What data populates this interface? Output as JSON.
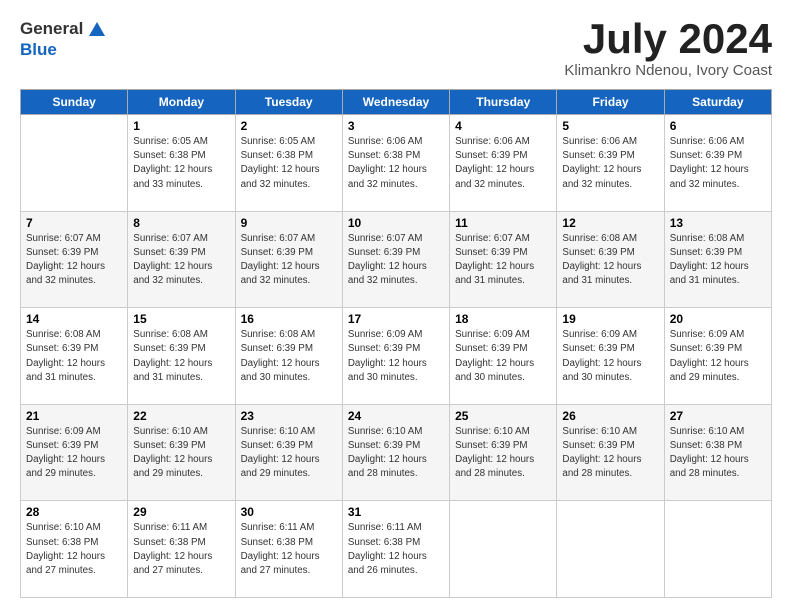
{
  "header": {
    "logo_general": "General",
    "logo_blue": "Blue",
    "month_title": "July 2024",
    "location": "Klimankro Ndenou, Ivory Coast"
  },
  "calendar": {
    "days_of_week": [
      "Sunday",
      "Monday",
      "Tuesday",
      "Wednesday",
      "Thursday",
      "Friday",
      "Saturday"
    ],
    "weeks": [
      [
        {
          "day": "",
          "sunrise": "",
          "sunset": "",
          "daylight": ""
        },
        {
          "day": "1",
          "sunrise": "Sunrise: 6:05 AM",
          "sunset": "Sunset: 6:38 PM",
          "daylight": "Daylight: 12 hours and 33 minutes."
        },
        {
          "day": "2",
          "sunrise": "Sunrise: 6:05 AM",
          "sunset": "Sunset: 6:38 PM",
          "daylight": "Daylight: 12 hours and 32 minutes."
        },
        {
          "day": "3",
          "sunrise": "Sunrise: 6:06 AM",
          "sunset": "Sunset: 6:38 PM",
          "daylight": "Daylight: 12 hours and 32 minutes."
        },
        {
          "day": "4",
          "sunrise": "Sunrise: 6:06 AM",
          "sunset": "Sunset: 6:39 PM",
          "daylight": "Daylight: 12 hours and 32 minutes."
        },
        {
          "day": "5",
          "sunrise": "Sunrise: 6:06 AM",
          "sunset": "Sunset: 6:39 PM",
          "daylight": "Daylight: 12 hours and 32 minutes."
        },
        {
          "day": "6",
          "sunrise": "Sunrise: 6:06 AM",
          "sunset": "Sunset: 6:39 PM",
          "daylight": "Daylight: 12 hours and 32 minutes."
        }
      ],
      [
        {
          "day": "7",
          "sunrise": "Sunrise: 6:07 AM",
          "sunset": "Sunset: 6:39 PM",
          "daylight": "Daylight: 12 hours and 32 minutes."
        },
        {
          "day": "8",
          "sunrise": "Sunrise: 6:07 AM",
          "sunset": "Sunset: 6:39 PM",
          "daylight": "Daylight: 12 hours and 32 minutes."
        },
        {
          "day": "9",
          "sunrise": "Sunrise: 6:07 AM",
          "sunset": "Sunset: 6:39 PM",
          "daylight": "Daylight: 12 hours and 32 minutes."
        },
        {
          "day": "10",
          "sunrise": "Sunrise: 6:07 AM",
          "sunset": "Sunset: 6:39 PM",
          "daylight": "Daylight: 12 hours and 32 minutes."
        },
        {
          "day": "11",
          "sunrise": "Sunrise: 6:07 AM",
          "sunset": "Sunset: 6:39 PM",
          "daylight": "Daylight: 12 hours and 31 minutes."
        },
        {
          "day": "12",
          "sunrise": "Sunrise: 6:08 AM",
          "sunset": "Sunset: 6:39 PM",
          "daylight": "Daylight: 12 hours and 31 minutes."
        },
        {
          "day": "13",
          "sunrise": "Sunrise: 6:08 AM",
          "sunset": "Sunset: 6:39 PM",
          "daylight": "Daylight: 12 hours and 31 minutes."
        }
      ],
      [
        {
          "day": "14",
          "sunrise": "Sunrise: 6:08 AM",
          "sunset": "Sunset: 6:39 PM",
          "daylight": "Daylight: 12 hours and 31 minutes."
        },
        {
          "day": "15",
          "sunrise": "Sunrise: 6:08 AM",
          "sunset": "Sunset: 6:39 PM",
          "daylight": "Daylight: 12 hours and 31 minutes."
        },
        {
          "day": "16",
          "sunrise": "Sunrise: 6:08 AM",
          "sunset": "Sunset: 6:39 PM",
          "daylight": "Daylight: 12 hours and 30 minutes."
        },
        {
          "day": "17",
          "sunrise": "Sunrise: 6:09 AM",
          "sunset": "Sunset: 6:39 PM",
          "daylight": "Daylight: 12 hours and 30 minutes."
        },
        {
          "day": "18",
          "sunrise": "Sunrise: 6:09 AM",
          "sunset": "Sunset: 6:39 PM",
          "daylight": "Daylight: 12 hours and 30 minutes."
        },
        {
          "day": "19",
          "sunrise": "Sunrise: 6:09 AM",
          "sunset": "Sunset: 6:39 PM",
          "daylight": "Daylight: 12 hours and 30 minutes."
        },
        {
          "day": "20",
          "sunrise": "Sunrise: 6:09 AM",
          "sunset": "Sunset: 6:39 PM",
          "daylight": "Daylight: 12 hours and 29 minutes."
        }
      ],
      [
        {
          "day": "21",
          "sunrise": "Sunrise: 6:09 AM",
          "sunset": "Sunset: 6:39 PM",
          "daylight": "Daylight: 12 hours and 29 minutes."
        },
        {
          "day": "22",
          "sunrise": "Sunrise: 6:10 AM",
          "sunset": "Sunset: 6:39 PM",
          "daylight": "Daylight: 12 hours and 29 minutes."
        },
        {
          "day": "23",
          "sunrise": "Sunrise: 6:10 AM",
          "sunset": "Sunset: 6:39 PM",
          "daylight": "Daylight: 12 hours and 29 minutes."
        },
        {
          "day": "24",
          "sunrise": "Sunrise: 6:10 AM",
          "sunset": "Sunset: 6:39 PM",
          "daylight": "Daylight: 12 hours and 28 minutes."
        },
        {
          "day": "25",
          "sunrise": "Sunrise: 6:10 AM",
          "sunset": "Sunset: 6:39 PM",
          "daylight": "Daylight: 12 hours and 28 minutes."
        },
        {
          "day": "26",
          "sunrise": "Sunrise: 6:10 AM",
          "sunset": "Sunset: 6:39 PM",
          "daylight": "Daylight: 12 hours and 28 minutes."
        },
        {
          "day": "27",
          "sunrise": "Sunrise: 6:10 AM",
          "sunset": "Sunset: 6:38 PM",
          "daylight": "Daylight: 12 hours and 28 minutes."
        }
      ],
      [
        {
          "day": "28",
          "sunrise": "Sunrise: 6:10 AM",
          "sunset": "Sunset: 6:38 PM",
          "daylight": "Daylight: 12 hours and 27 minutes."
        },
        {
          "day": "29",
          "sunrise": "Sunrise: 6:11 AM",
          "sunset": "Sunset: 6:38 PM",
          "daylight": "Daylight: 12 hours and 27 minutes."
        },
        {
          "day": "30",
          "sunrise": "Sunrise: 6:11 AM",
          "sunset": "Sunset: 6:38 PM",
          "daylight": "Daylight: 12 hours and 27 minutes."
        },
        {
          "day": "31",
          "sunrise": "Sunrise: 6:11 AM",
          "sunset": "Sunset: 6:38 PM",
          "daylight": "Daylight: 12 hours and 26 minutes."
        },
        {
          "day": "",
          "sunrise": "",
          "sunset": "",
          "daylight": ""
        },
        {
          "day": "",
          "sunrise": "",
          "sunset": "",
          "daylight": ""
        },
        {
          "day": "",
          "sunrise": "",
          "sunset": "",
          "daylight": ""
        }
      ]
    ]
  }
}
